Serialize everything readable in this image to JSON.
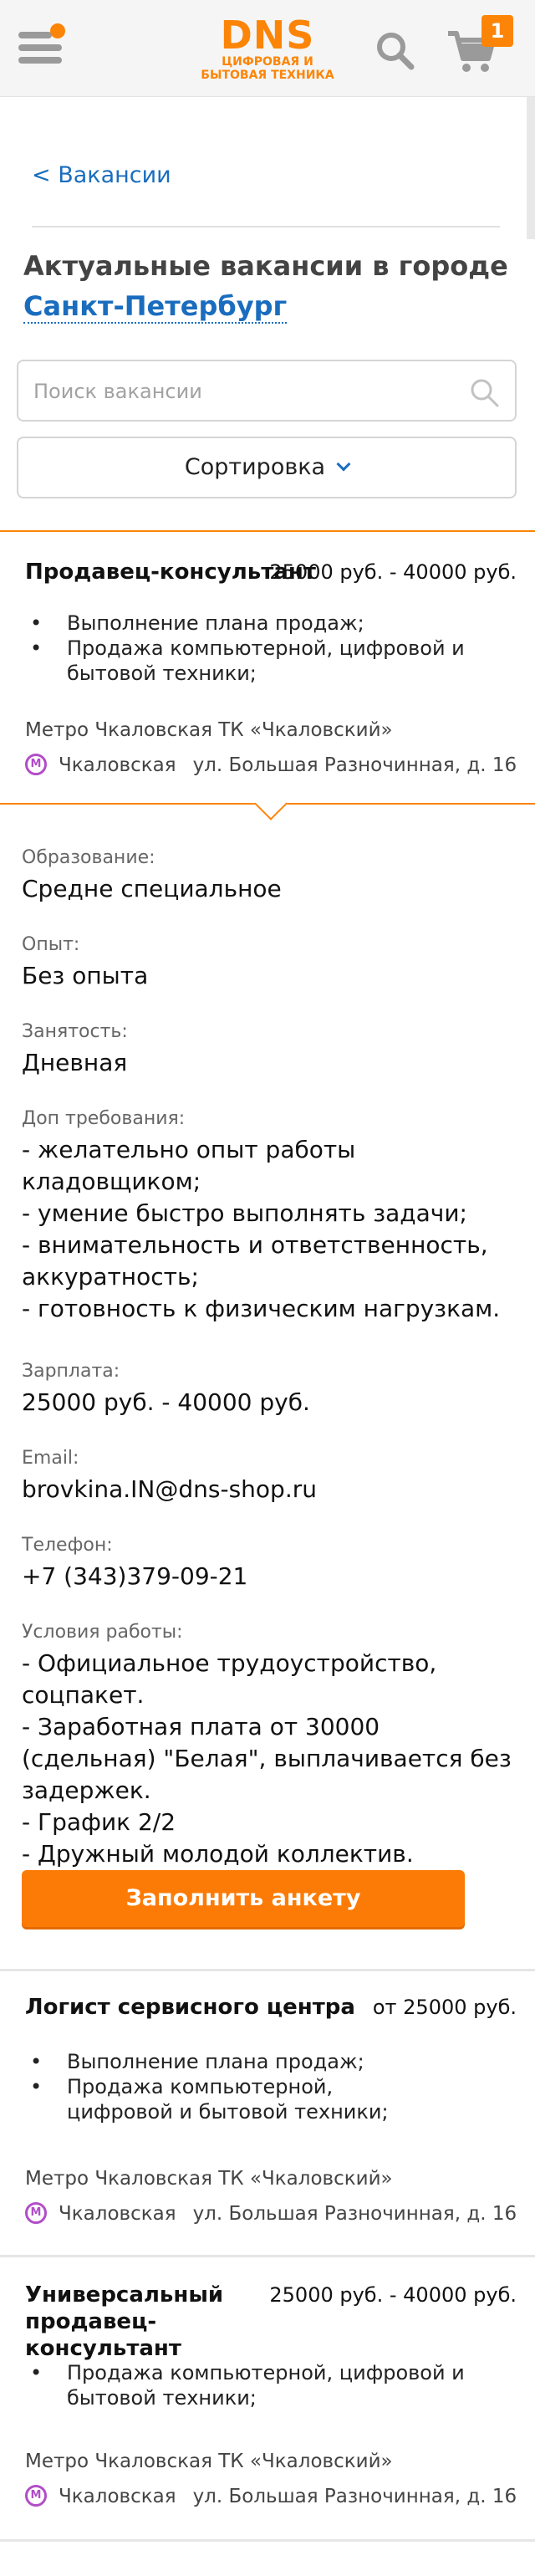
{
  "header": {
    "logo_main": "DNS",
    "logo_sub": "ЦИФРОВАЯ И БЫТОВАЯ ТЕХНИКА",
    "cart_count": "1",
    "accent_color": "#fc8507",
    "icons": [
      "menu-icon",
      "search-icon",
      "cart-icon"
    ]
  },
  "breadcrumb": "< Вакансии",
  "title": {
    "prefix": "Актуальные вакансии в городе",
    "city": "Санкт-Петербург"
  },
  "search": {
    "placeholder": "Поиск вакансии",
    "value": ""
  },
  "sort": {
    "label": "Сортировка"
  },
  "vacancies": [
    {
      "title": "Продавец-консультант",
      "salary": "25000 руб. - 40000 руб.",
      "duties": [
        "Выполнение плана продаж;",
        "Продажа компьютерной, цифровой и бытовой техники;"
      ],
      "metro_line": "Метро Чкаловская ТК «Чкаловский»",
      "station": "Чкаловская",
      "address": "ул. Большая Разночинная, д. 16"
    },
    {
      "title": "Логист сервисного центра",
      "salary": "от 25000 руб.",
      "duties": [
        "Выполнение плана продаж;",
        "Продажа компьютерной, цифровой и бытовой техники;"
      ],
      "metro_line": "Метро Чкаловская ТК «Чкаловский»",
      "station": "Чкаловская",
      "address": "ул. Большая Разночинная, д. 16"
    },
    {
      "title": "Универсальный продавец-консультант",
      "salary": "25000 руб. - 40000 руб.",
      "duties": [
        "Продажа компьютерной, цифровой и бытовой техники;"
      ],
      "metro_line": "Метро Чкаловская ТК «Чкаловский»",
      "station": "Чкаловская",
      "address": "ул. Большая Разночинная, д. 16"
    }
  ],
  "details": {
    "education_label": "Образование:",
    "education": "Средне специальное",
    "experience_label": "Опыт:",
    "experience": "Без опыта",
    "employment_label": "Занятость:",
    "employment": "Дневная",
    "requirements_label": "Доп требования:",
    "requirements": "- желательно опыт работы кладовщиком;\n- умение быстро выполнять задачи;\n- внимательность и ответственность, аккуратность;\n- готовность к физическим нагрузкам.",
    "salary_label": "Зарплата:",
    "salary": "25000 руб. - 40000 руб.",
    "email_label": "Email:",
    "email": "brovkina.IN@dns-shop.ru",
    "phone_label": "Телефон:",
    "phone": "+7 (343)379-09-21",
    "conditions_label": "Условия работы:",
    "conditions": "- Официальное трудоустройство, соцпакет.\n- Заработная плата от 30000 (сдельная) \"Белая\", выплачивается без задержек.\n- График 2/2\n- Дружный молодой коллектив.",
    "apply_label": "Заполнить анкету"
  }
}
